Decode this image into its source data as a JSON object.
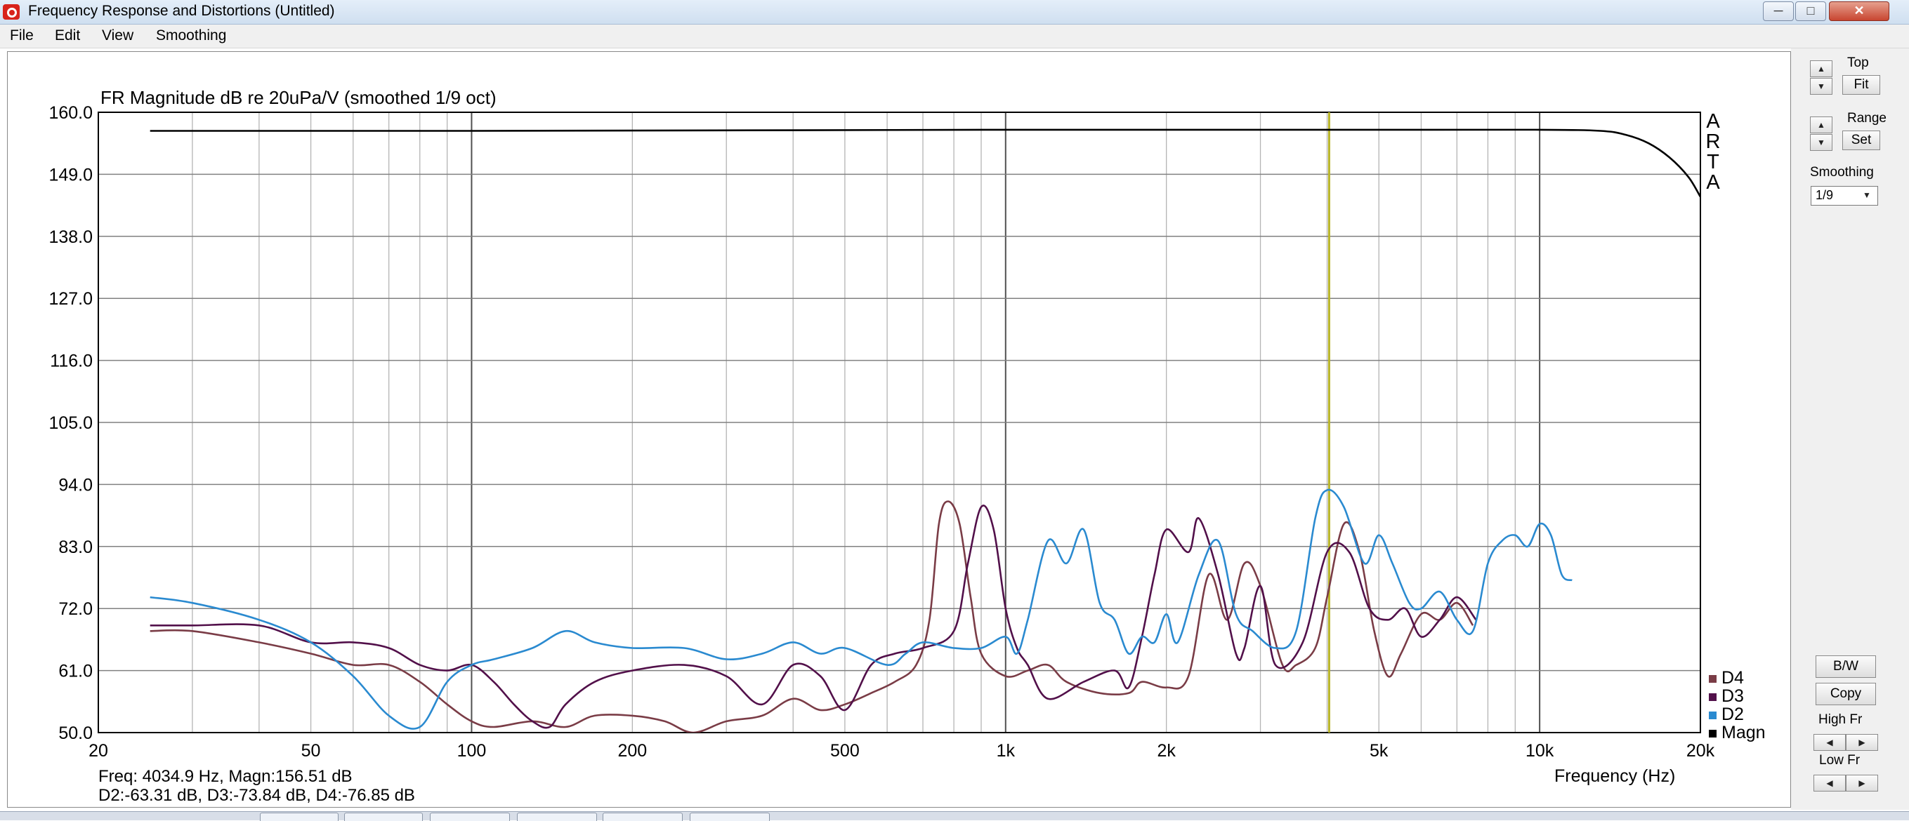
{
  "window": {
    "title": "Frequency Response and Distortions (Untitled)",
    "min_glyph": "─",
    "max_glyph": "□",
    "close_glyph": "✕"
  },
  "menu": [
    "File",
    "Edit",
    "View",
    "Smoothing"
  ],
  "panel": {
    "top_label": "Top",
    "fit_button": "Fit",
    "range_label": "Range",
    "set_button": "Set",
    "smoothing_label": "Smoothing",
    "smoothing_value": "1/9",
    "bw_button": "B/W",
    "copy_button": "Copy",
    "high_fr_label": "High Fr",
    "low_fr_label": "Low Fr",
    "arrow_up": "▲",
    "arrow_down": "▼",
    "arrow_left": "◀",
    "arrow_right": "▶"
  },
  "status": {
    "line1": "Freq: 4034.9 Hz, Magn:156.51 dB",
    "line2": "D2:-63.31 dB, D3:-73.84 dB, D4:-76.85 dB"
  },
  "chart_data": {
    "type": "line",
    "title": "FR Magnitude dB re 20uPa/V (smoothed 1/9 oct)",
    "xlabel": "Frequency (Hz)",
    "ylabel": "",
    "x_scale": "log",
    "xlim": [
      20,
      20000
    ],
    "ylim": [
      50,
      160
    ],
    "y_ticks": [
      "160.0",
      "149.0",
      "138.0",
      "127.0",
      "116.0",
      "105.0",
      "94.0",
      "83.0",
      "72.0",
      "61.0",
      "50.0"
    ],
    "x_ticks": [
      {
        "value": 20,
        "label": "20"
      },
      {
        "value": 50,
        "label": "50"
      },
      {
        "value": 100,
        "label": "100"
      },
      {
        "value": 200,
        "label": "200"
      },
      {
        "value": 500,
        "label": "500"
      },
      {
        "value": 1000,
        "label": "1k"
      },
      {
        "value": 2000,
        "label": "2k"
      },
      {
        "value": 5000,
        "label": "5k"
      },
      {
        "value": 10000,
        "label": "10k"
      },
      {
        "value": 20000,
        "label": "20k"
      }
    ],
    "watermark": "ARTA",
    "cursor": {
      "x": 4034.9,
      "color": "#b8b428"
    },
    "grid": true,
    "legend_position": "bottom-right",
    "series": [
      {
        "name": "D4",
        "color": "#7a3c46",
        "points": [
          [
            25,
            68
          ],
          [
            30,
            68
          ],
          [
            40,
            66
          ],
          [
            50,
            64
          ],
          [
            60,
            62
          ],
          [
            70,
            62
          ],
          [
            80,
            59
          ],
          [
            90,
            55
          ],
          [
            100,
            52
          ],
          [
            110,
            51
          ],
          [
            130,
            52
          ],
          [
            150,
            51
          ],
          [
            170,
            53
          ],
          [
            200,
            53
          ],
          [
            230,
            52
          ],
          [
            260,
            50
          ],
          [
            300,
            52
          ],
          [
            350,
            53
          ],
          [
            400,
            56
          ],
          [
            450,
            54
          ],
          [
            500,
            55
          ],
          [
            560,
            57
          ],
          [
            620,
            59
          ],
          [
            680,
            62
          ],
          [
            720,
            70
          ],
          [
            750,
            87
          ],
          [
            780,
            91
          ],
          [
            820,
            87
          ],
          [
            860,
            74
          ],
          [
            900,
            64
          ],
          [
            1000,
            60
          ],
          [
            1100,
            61
          ],
          [
            1200,
            62
          ],
          [
            1300,
            59
          ],
          [
            1500,
            57
          ],
          [
            1700,
            57
          ],
          [
            1800,
            59
          ],
          [
            2000,
            58
          ],
          [
            2200,
            60
          ],
          [
            2400,
            78
          ],
          [
            2600,
            70
          ],
          [
            2800,
            80
          ],
          [
            3000,
            76
          ],
          [
            3300,
            62
          ],
          [
            3500,
            62
          ],
          [
            3800,
            65
          ],
          [
            4000,
            74
          ],
          [
            4300,
            87
          ],
          [
            4600,
            82
          ],
          [
            4900,
            68
          ],
          [
            5200,
            60
          ],
          [
            5500,
            64
          ],
          [
            6000,
            71
          ],
          [
            6500,
            70
          ],
          [
            7000,
            73
          ],
          [
            7500,
            69
          ]
        ]
      },
      {
        "name": "D3",
        "color": "#52104a",
        "points": [
          [
            25,
            69
          ],
          [
            30,
            69
          ],
          [
            40,
            69
          ],
          [
            50,
            66
          ],
          [
            60,
            66
          ],
          [
            70,
            65
          ],
          [
            80,
            62
          ],
          [
            90,
            61
          ],
          [
            100,
            62
          ],
          [
            110,
            59
          ],
          [
            120,
            55
          ],
          [
            130,
            52
          ],
          [
            140,
            51
          ],
          [
            150,
            55
          ],
          [
            170,
            59
          ],
          [
            200,
            61
          ],
          [
            250,
            62
          ],
          [
            300,
            60
          ],
          [
            350,
            55
          ],
          [
            400,
            62
          ],
          [
            450,
            60
          ],
          [
            500,
            54
          ],
          [
            560,
            62
          ],
          [
            620,
            64
          ],
          [
            700,
            65
          ],
          [
            800,
            68
          ],
          [
            850,
            80
          ],
          [
            900,
            90
          ],
          [
            950,
            86
          ],
          [
            1000,
            72
          ],
          [
            1050,
            65
          ],
          [
            1100,
            62
          ],
          [
            1200,
            56
          ],
          [
            1400,
            59
          ],
          [
            1600,
            61
          ],
          [
            1700,
            58
          ],
          [
            1800,
            67
          ],
          [
            1900,
            78
          ],
          [
            2000,
            86
          ],
          [
            2200,
            82
          ],
          [
            2300,
            88
          ],
          [
            2500,
            78
          ],
          [
            2700,
            64
          ],
          [
            2800,
            65
          ],
          [
            3000,
            76
          ],
          [
            3200,
            62
          ],
          [
            3600,
            66
          ],
          [
            4000,
            82
          ],
          [
            4400,
            82
          ],
          [
            4800,
            72
          ],
          [
            5200,
            70
          ],
          [
            5600,
            72
          ],
          [
            6000,
            67
          ],
          [
            6500,
            70
          ],
          [
            7000,
            74
          ],
          [
            7600,
            70
          ]
        ]
      },
      {
        "name": "D2",
        "color": "#2a8ad0",
        "points": [
          [
            25,
            74
          ],
          [
            30,
            73
          ],
          [
            40,
            70
          ],
          [
            50,
            66
          ],
          [
            60,
            60
          ],
          [
            70,
            53
          ],
          [
            80,
            51
          ],
          [
            90,
            59
          ],
          [
            100,
            62
          ],
          [
            110,
            63
          ],
          [
            130,
            65
          ],
          [
            150,
            68
          ],
          [
            170,
            66
          ],
          [
            200,
            65
          ],
          [
            250,
            65
          ],
          [
            300,
            63
          ],
          [
            350,
            64
          ],
          [
            400,
            66
          ],
          [
            450,
            64
          ],
          [
            500,
            65
          ],
          [
            600,
            62
          ],
          [
            650,
            64
          ],
          [
            700,
            66
          ],
          [
            800,
            65
          ],
          [
            900,
            65
          ],
          [
            1000,
            67
          ],
          [
            1050,
            64
          ],
          [
            1100,
            70
          ],
          [
            1200,
            84
          ],
          [
            1300,
            80
          ],
          [
            1400,
            86
          ],
          [
            1500,
            73
          ],
          [
            1600,
            70
          ],
          [
            1700,
            64
          ],
          [
            1800,
            67
          ],
          [
            1900,
            66
          ],
          [
            2000,
            71
          ],
          [
            2100,
            66
          ],
          [
            2300,
            78
          ],
          [
            2500,
            84
          ],
          [
            2700,
            71
          ],
          [
            2900,
            68
          ],
          [
            3200,
            65
          ],
          [
            3500,
            68
          ],
          [
            3800,
            88
          ],
          [
            4000,
            93
          ],
          [
            4300,
            90
          ],
          [
            4700,
            80
          ],
          [
            5000,
            85
          ],
          [
            5300,
            80
          ],
          [
            5700,
            73
          ],
          [
            6000,
            72
          ],
          [
            6500,
            75
          ],
          [
            7000,
            70
          ],
          [
            7500,
            68
          ],
          [
            8000,
            80
          ],
          [
            8500,
            84
          ],
          [
            9000,
            85
          ],
          [
            9500,
            83
          ],
          [
            10000,
            87
          ],
          [
            10500,
            85
          ],
          [
            11000,
            78
          ],
          [
            11500,
            77
          ]
        ]
      },
      {
        "name": "Magn",
        "color": "#000000",
        "points": [
          [
            25,
            156.7
          ],
          [
            100,
            156.7
          ],
          [
            1000,
            156.9
          ],
          [
            5000,
            156.9
          ],
          [
            10000,
            156.9
          ],
          [
            13000,
            156.7
          ],
          [
            14500,
            156.0
          ],
          [
            16000,
            154.5
          ],
          [
            17500,
            152.0
          ],
          [
            19000,
            148.5
          ],
          [
            20000,
            145.0
          ]
        ]
      }
    ]
  }
}
